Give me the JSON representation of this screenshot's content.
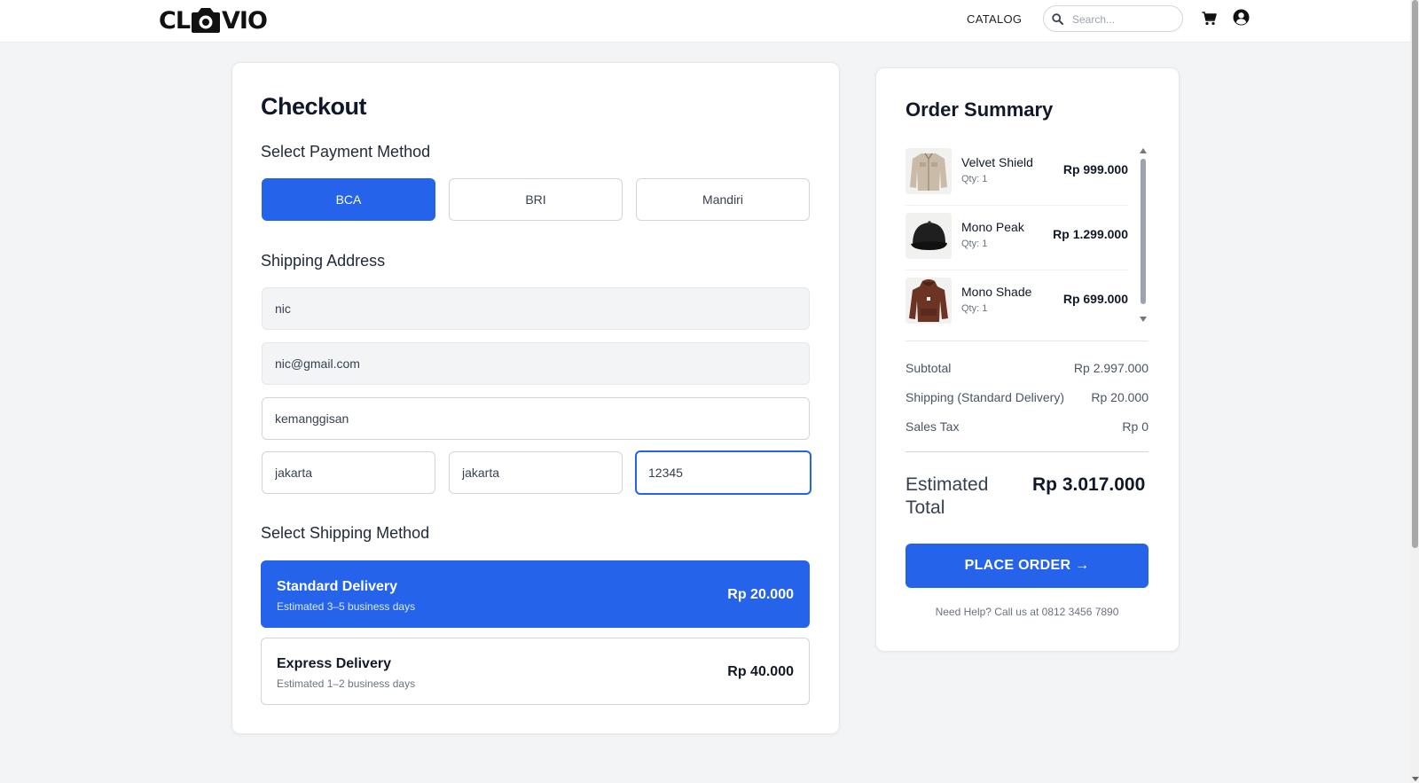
{
  "header": {
    "logo_text_left": "CL",
    "logo_text_right": "VIO",
    "nav_catalog": "CATALOG",
    "search_placeholder": "Search..."
  },
  "checkout": {
    "title": "Checkout",
    "payment_section_title": "Select Payment Method",
    "payment_methods": [
      {
        "label": "BCA",
        "selected": true
      },
      {
        "label": "BRI",
        "selected": false
      },
      {
        "label": "Mandiri",
        "selected": false
      }
    ],
    "address_section_title": "Shipping Address",
    "address": {
      "name": "nic",
      "email": "nic@gmail.com",
      "street": "kemanggisan",
      "city": "jakarta",
      "province": "jakarta",
      "postal_code": "12345"
    },
    "shipping_section_title": "Select Shipping Method",
    "shipping_methods": [
      {
        "name": "Standard Delivery",
        "eta": "Estimated 3–5 business days",
        "price": "Rp 20.000",
        "selected": true
      },
      {
        "name": "Express Delivery",
        "eta": "Estimated 1–2 business days",
        "price": "Rp 40.000",
        "selected": false
      }
    ]
  },
  "summary": {
    "title": "Order Summary",
    "items": [
      {
        "name": "Velvet Shield",
        "qty": "Qty: 1",
        "price": "Rp 999.000",
        "image": "beige-jacket"
      },
      {
        "name": "Mono Peak",
        "qty": "Qty: 1",
        "price": "Rp 1.299.000",
        "image": "black-cap"
      },
      {
        "name": "Mono Shade",
        "qty": "Qty: 1",
        "price": "Rp 699.000",
        "image": "brown-hoodie"
      }
    ],
    "subtotal_label": "Subtotal",
    "subtotal_value": "Rp 2.997.000",
    "shipping_label": "Shipping (Standard Delivery)",
    "shipping_value": "Rp 20.000",
    "tax_label": "Sales Tax",
    "tax_value": "Rp 0",
    "estimated_total_label": "Estimated Total",
    "estimated_total_value": "Rp 3.017.000",
    "place_order_label": "PLACE ORDER →",
    "help_text": "Need Help? Call us at 0812 3456 7890"
  },
  "colors": {
    "accent": "#2563eb",
    "background": "#f3f4f6"
  },
  "icons": [
    "camera-logo-icon",
    "search-icon",
    "cart-icon",
    "user-icon"
  ]
}
